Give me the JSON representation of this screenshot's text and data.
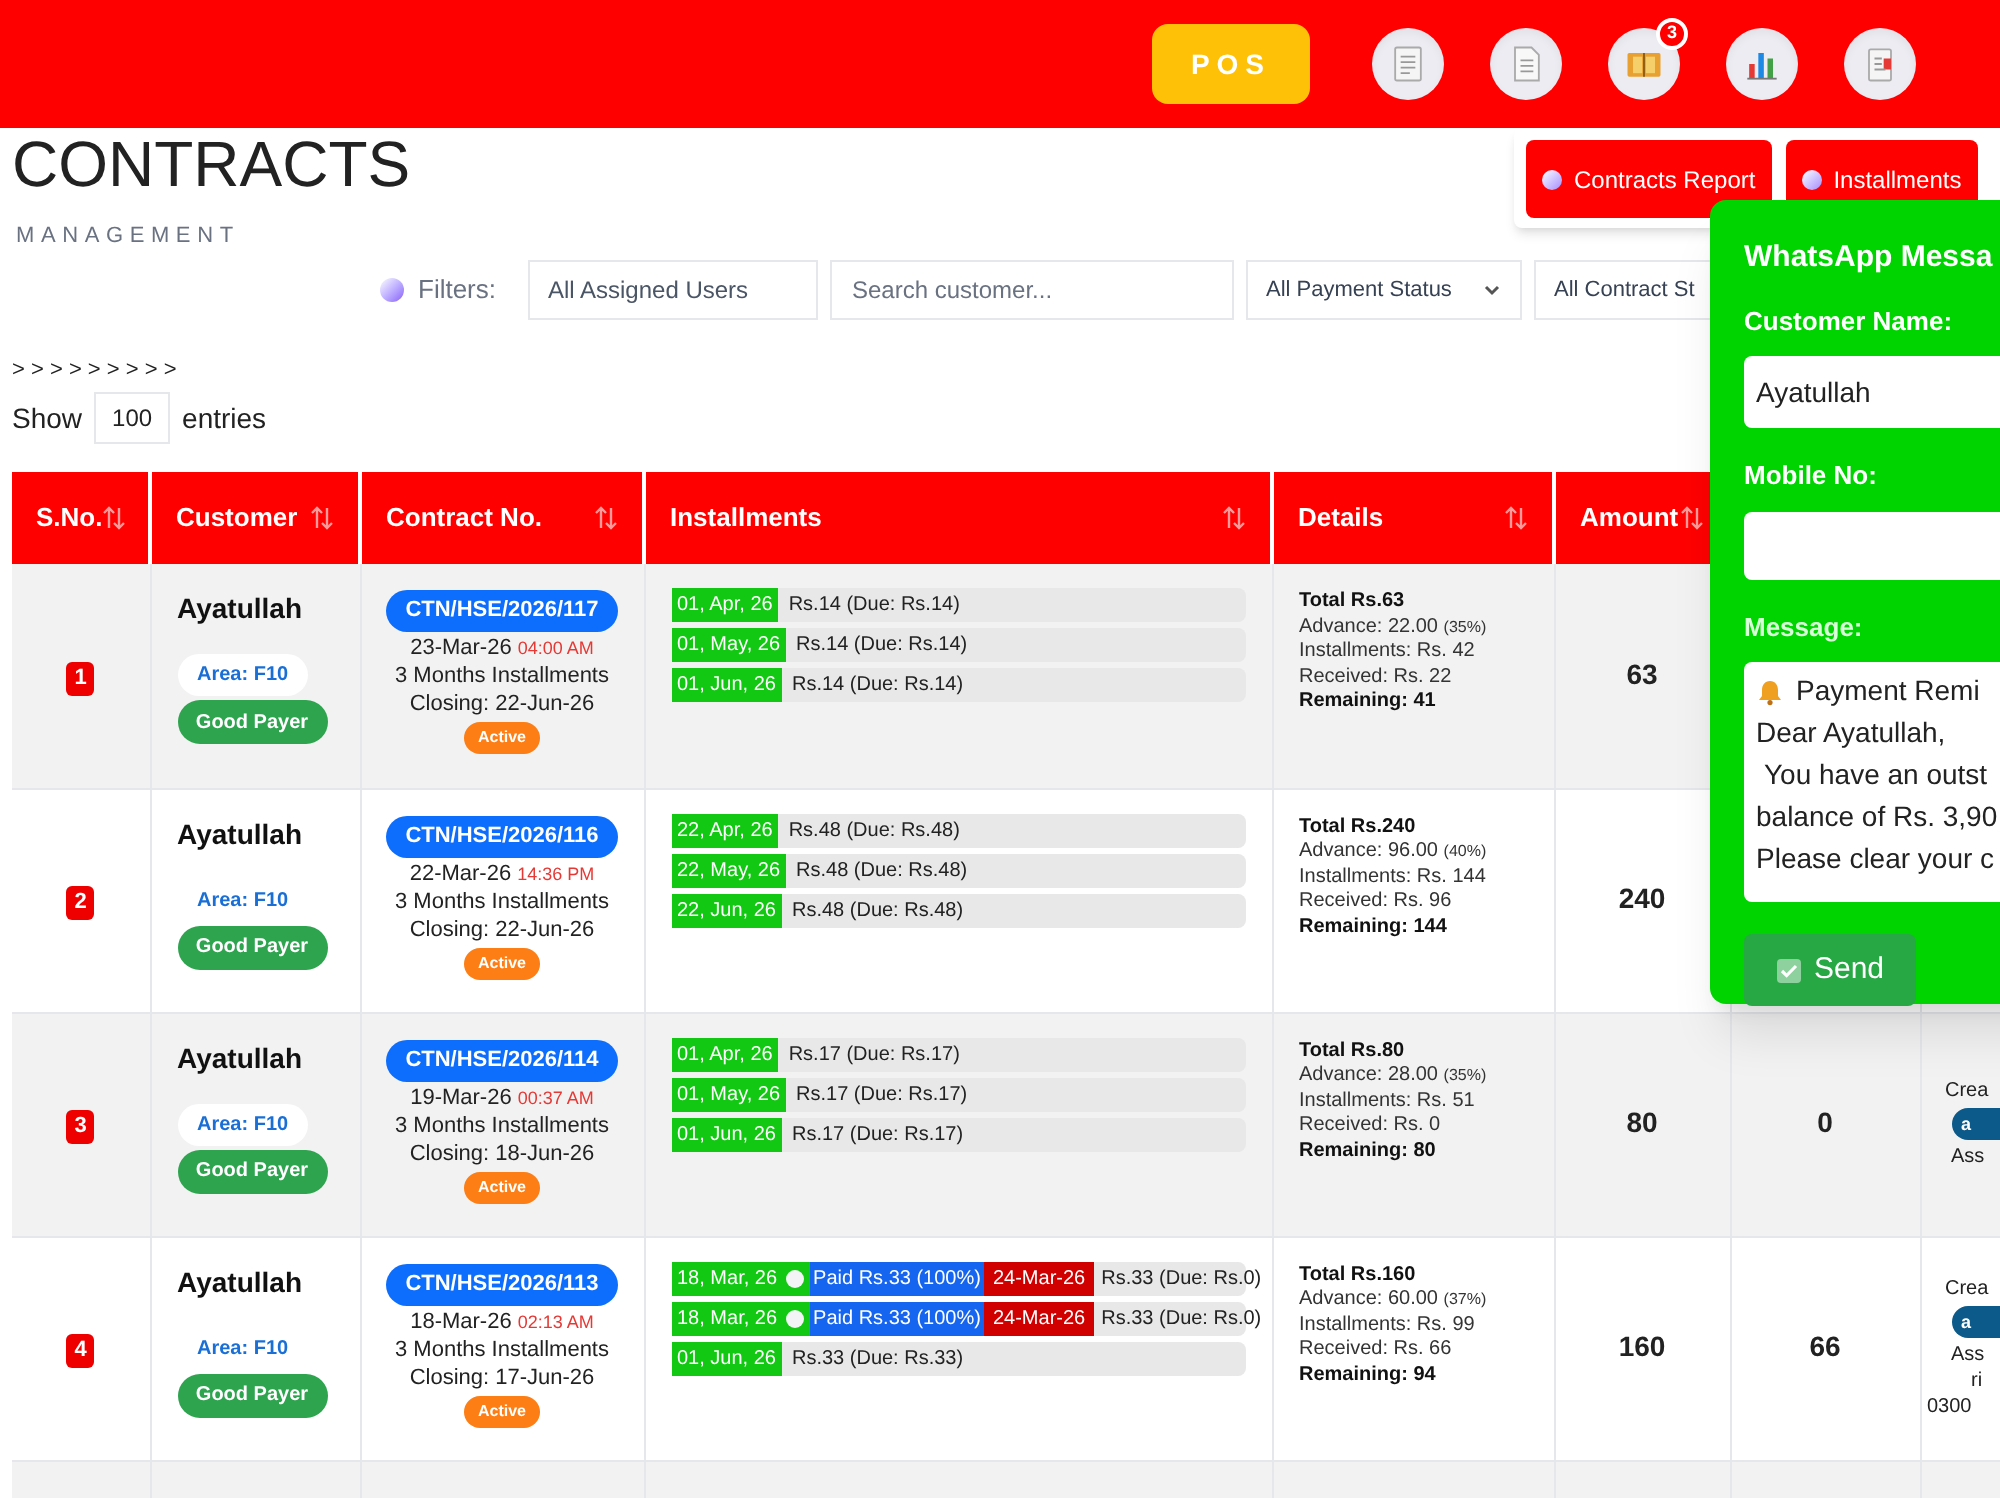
{
  "topbar": {
    "pos_label": "POS",
    "nav_icons": [
      {
        "kind": "list"
      },
      {
        "kind": "document"
      },
      {
        "kind": "book",
        "badge": "3"
      },
      {
        "kind": "chart"
      },
      {
        "kind": "clipboard"
      }
    ]
  },
  "header": {
    "title": "CONTRACTS",
    "subtitle": "MANAGEMENT",
    "report_buttons": [
      "Contracts Report",
      "Installments"
    ]
  },
  "filters": {
    "label": "Filters:",
    "fields": [
      {
        "kind": "select",
        "value": "All Assigned Users"
      },
      {
        "kind": "search",
        "placeholder": "Search customer..."
      },
      {
        "kind": "dropdown",
        "value": "All Payment Status"
      },
      {
        "kind": "dropdown",
        "value": "All Contract St"
      }
    ]
  },
  "breadcrumb": "> > > > > > > > >",
  "length": {
    "before": "Show",
    "value": "100",
    "after": "entries"
  },
  "table": {
    "columns": [
      "S.No.",
      "Customer",
      "Contract No.",
      "Installments",
      "Details",
      "Amount"
    ],
    "rows": [
      {
        "sno": "1",
        "customer": "Ayatullah",
        "area": "Area: F10",
        "tag": "Good Payer",
        "contract_no": "CTN/HSE/2026/117",
        "date": "23-Mar-26",
        "time": "04:00 AM",
        "plan": "3 Months Installments",
        "closing": "Closing: 22-Jun-26",
        "status": "Active",
        "installments": [
          {
            "kind": "pending",
            "date": "01, Apr, 26",
            "amount": "Rs.14 (Due: Rs.14)"
          },
          {
            "kind": "pending",
            "date": "01, May, 26",
            "amount": "Rs.14 (Due: Rs.14)"
          },
          {
            "kind": "pending",
            "date": "01, Jun, 26",
            "amount": "Rs.14 (Due: Rs.14)"
          }
        ],
        "details": {
          "total": "Total Rs.63",
          "advance": "Advance: 22.00",
          "advance_pct": "(35%)",
          "installments": "Installments: Rs. 42",
          "received": "Received: Rs. 22",
          "remaining": "Remaining: 41"
        },
        "amount": "63"
      },
      {
        "sno": "2",
        "customer": "Ayatullah",
        "area": "Area: F10",
        "tag": "Good Payer",
        "contract_no": "CTN/HSE/2026/116",
        "date": "22-Mar-26",
        "time": "14:36 PM",
        "plan": "3 Months Installments",
        "closing": "Closing: 22-Jun-26",
        "status": "Active",
        "installments": [
          {
            "kind": "pending",
            "date": "22, Apr, 26",
            "amount": "Rs.48 (Due: Rs.48)"
          },
          {
            "kind": "pending",
            "date": "22, May, 26",
            "amount": "Rs.48 (Due: Rs.48)"
          },
          {
            "kind": "pending",
            "date": "22, Jun, 26",
            "amount": "Rs.48 (Due: Rs.48)"
          }
        ],
        "details": {
          "total": "Total Rs.240",
          "advance": "Advance: 96.00",
          "advance_pct": "(40%)",
          "installments": "Installments: Rs. 144",
          "received": "Received: Rs. 96",
          "remaining": "Remaining: 144"
        },
        "amount": "240"
      },
      {
        "sno": "3",
        "customer": "Ayatullah",
        "area": "Area: F10",
        "tag": "Good Payer",
        "contract_no": "CTN/HSE/2026/114",
        "date": "19-Mar-26",
        "time": "00:37 AM",
        "plan": "3 Months Installments",
        "closing": "Closing: 18-Jun-26",
        "status": "Active",
        "installments": [
          {
            "kind": "pending",
            "date": "01, Apr, 26",
            "amount": "Rs.17 (Due: Rs.17)"
          },
          {
            "kind": "pending",
            "date": "01, May, 26",
            "amount": "Rs.17 (Due: Rs.17)"
          },
          {
            "kind": "pending",
            "date": "01, Jun, 26",
            "amount": "Rs.17 (Due: Rs.17)"
          }
        ],
        "details": {
          "total": "Total Rs.80",
          "advance": "Advance: 28.00",
          "advance_pct": "(35%)",
          "installments": "Installments: Rs. 51",
          "received": "Received: Rs. 0",
          "remaining": "Remaining: 80"
        },
        "amount": "80",
        "column_7": "0",
        "column_8": {
          "created": "Crea",
          "badge": "a",
          "lines": [
            "Ass"
          ]
        }
      },
      {
        "sno": "4",
        "customer": "Ayatullah",
        "area": "Area: F10",
        "tag": "Good Payer",
        "contract_no": "CTN/HSE/2026/113",
        "date": "18-Mar-26",
        "time": "02:13 AM",
        "plan": "3 Months Installments",
        "closing": "Closing: 17-Jun-26",
        "status": "Active",
        "installments": [
          {
            "kind": "paid",
            "date": "18, Mar, 26",
            "paid": "Paid Rs.33 (100%)",
            "paid_date": "24-Mar-26",
            "amount": "Rs.33 (Due: Rs.0)"
          },
          {
            "kind": "paid",
            "date": "18, Mar, 26",
            "paid": "Paid Rs.33 (100%)",
            "paid_date": "24-Mar-26",
            "amount": "Rs.33 (Due: Rs.0)"
          },
          {
            "kind": "pending",
            "date": "01, Jun, 26",
            "amount": "Rs.33 (Due: Rs.33)"
          }
        ],
        "details": {
          "total": "Total Rs.160",
          "advance": "Advance: 60.00",
          "advance_pct": "(37%)",
          "installments": "Installments: Rs. 99",
          "received": "Received: Rs. 66",
          "remaining": "Remaining: 94"
        },
        "amount": "160",
        "column_7": "66",
        "column_8": {
          "created": "Crea",
          "badge": "a",
          "lines": [
            "Ass",
            "ri",
            "0300"
          ]
        }
      }
    ]
  },
  "whatsapp": {
    "title": "WhatsApp Messa",
    "name_label": "Customer Name:",
    "name_value": "Ayatullah",
    "mobile_label": "Mobile No:",
    "message_label": "Message:",
    "message_lines": [
      "Payment Remi",
      "Dear Ayatullah,",
      "You have an outst",
      "balance of Rs. 3,90",
      "Please clear your c"
    ],
    "send": "Send"
  }
}
